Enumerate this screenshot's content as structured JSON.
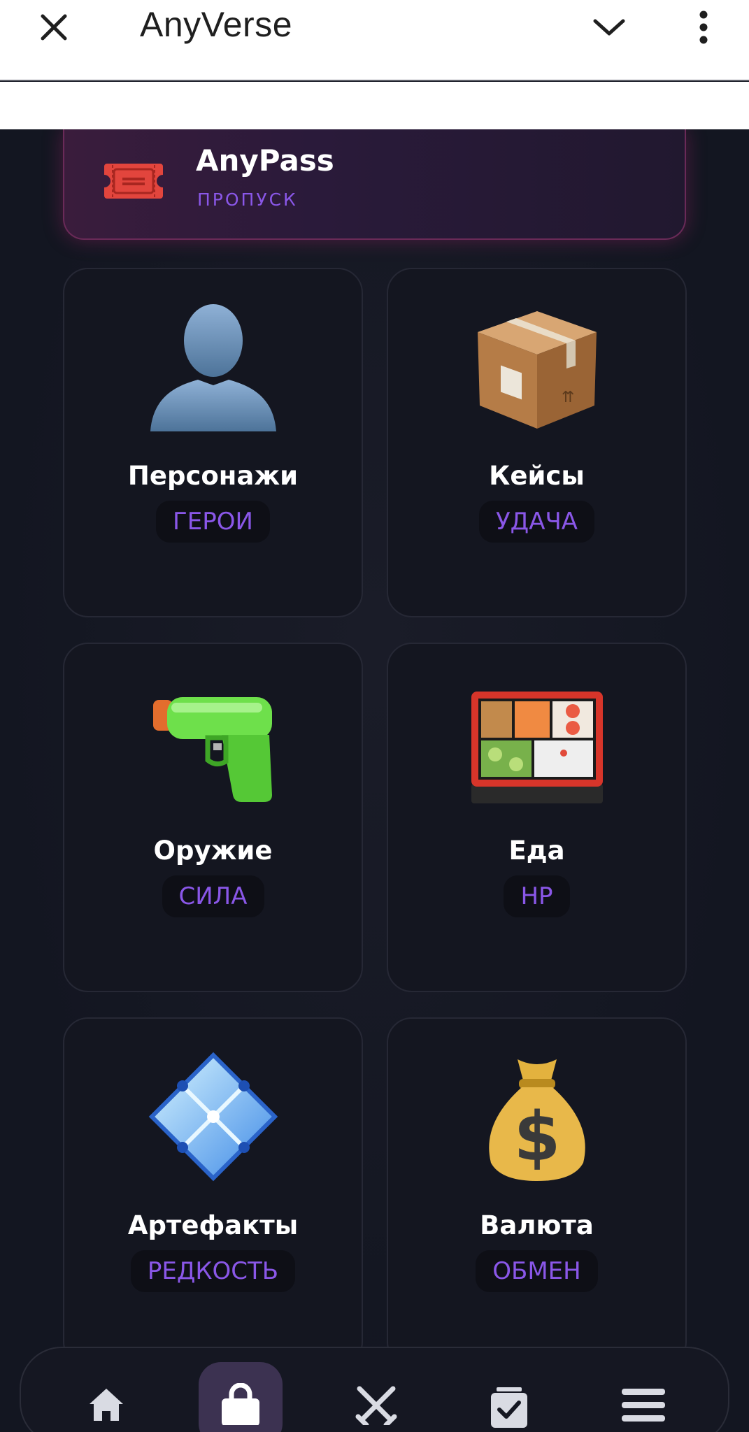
{
  "appbar": {
    "title": "AnyVerse",
    "close_icon": "close-icon",
    "dropdown_icon": "chevron-down-icon",
    "menu_icon": "more-vertical-icon"
  },
  "pass": {
    "title": "AnyPass",
    "subtitle": "ПРОПУСК",
    "icon": "ticket-icon"
  },
  "categories": [
    {
      "label": "Персонажи",
      "tag": "ГЕРОИ",
      "icon": "person-silhouette-icon"
    },
    {
      "label": "Кейсы",
      "tag": "УДАЧА",
      "icon": "package-box-icon"
    },
    {
      "label": "Оружие",
      "tag": "СИЛА",
      "icon": "water-pistol-icon"
    },
    {
      "label": "Еда",
      "tag": "HP",
      "icon": "bento-box-icon"
    },
    {
      "label": "Артефакты",
      "tag": "РЕДКОСТЬ",
      "icon": "diamond-crystal-icon"
    },
    {
      "label": "Валюта",
      "tag": "ОБМЕН",
      "icon": "money-bag-icon"
    }
  ],
  "bottom_nav": [
    {
      "icon": "home-icon",
      "active": false
    },
    {
      "icon": "shopping-bag-icon",
      "active": true
    },
    {
      "icon": "crossed-swords-icon",
      "active": false
    },
    {
      "icon": "task-check-icon",
      "active": false
    },
    {
      "icon": "hamburger-menu-icon",
      "active": false
    }
  ],
  "colors": {
    "accent": "#8a57e8",
    "background": "#131621",
    "pass_border": "#6a2a58",
    "ticket": "#e2453d"
  }
}
